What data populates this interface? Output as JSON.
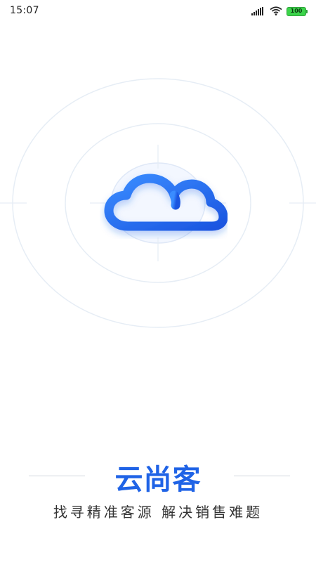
{
  "status_bar": {
    "time": "15:07",
    "battery": "100",
    "icons": [
      "signal-icon",
      "wifi-icon",
      "battery-icon"
    ]
  },
  "splash": {
    "app_name": "云尚客",
    "slogan": "找寻精准客源  解决销售难题"
  },
  "colors": {
    "brand_blue": "#1f63e6",
    "ring": "#e6edf5",
    "battery": "#3bd44a"
  }
}
